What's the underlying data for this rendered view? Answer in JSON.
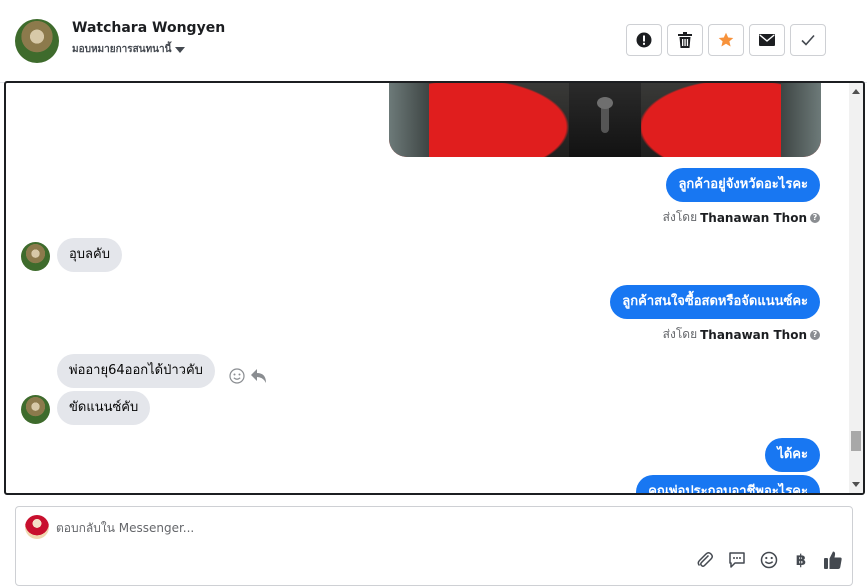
{
  "header": {
    "contact_name": "Watchara Wongyen",
    "assign_label": "มอบหมายการสนทนานี้",
    "actions": [
      "mark-spam",
      "delete",
      "star",
      "mark-unread",
      "mark-done"
    ],
    "star_color": "#f7923b"
  },
  "chat": {
    "messages": [
      {
        "from": "page",
        "text": "ลูกค้าอยู่จังหวัดอะไรคะ",
        "sent_by_prefix": "ส่งโดย",
        "sent_by_name": "Thanawan Thon"
      },
      {
        "from": "customer",
        "text": "อุบลคับ"
      },
      {
        "from": "page",
        "text": "ลูกค้าสนใจซื้อสดหรือจัดแนนซ์คะ",
        "sent_by_prefix": "ส่งโดย",
        "sent_by_name": "Thanawan Thon"
      },
      {
        "from": "customer",
        "text": "พ่ออายุ64ออกได้ป่าวคับ"
      },
      {
        "from": "customer",
        "text": "ขัดแนนซ์คับ"
      },
      {
        "from": "page",
        "text": "ได้คะ"
      },
      {
        "from": "page",
        "text": "คุณพ่อประกอบอาชีพอะไรคะ"
      }
    ],
    "outgoing_color": "#1877f2",
    "incoming_color": "#e4e6eb"
  },
  "composer": {
    "placeholder": "ตอบกลับใน Messenger...",
    "value": "",
    "tools": [
      "paperclip-icon",
      "saved-reply-icon",
      "emoji-icon",
      "baht-icon",
      "like-icon"
    ],
    "baht_symbol": "฿"
  }
}
